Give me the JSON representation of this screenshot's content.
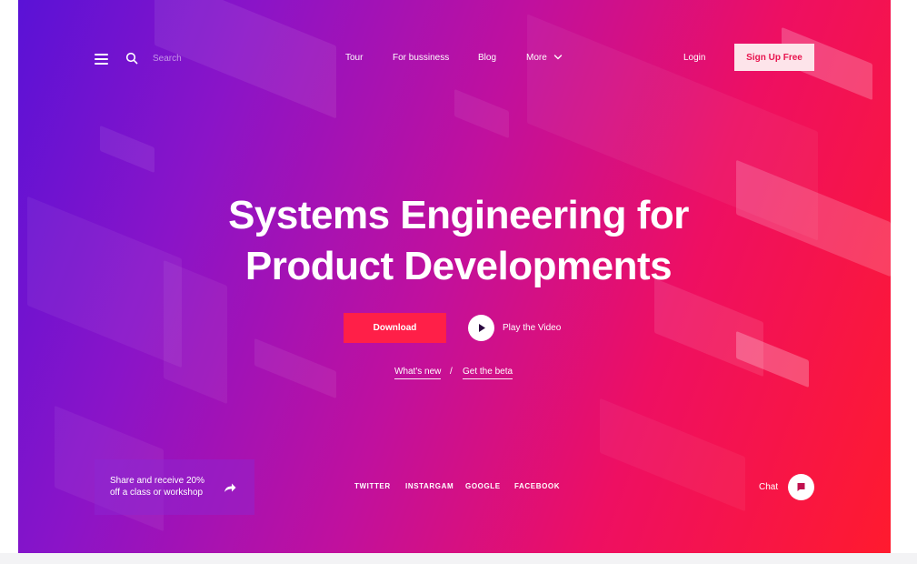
{
  "nav": {
    "search_placeholder": "Search",
    "links": [
      "Tour",
      "For bussiness",
      "Blog",
      "More"
    ],
    "login": "Login",
    "signup": "Sign Up Free"
  },
  "hero": {
    "headline_line1": "Systems Engineering for",
    "headline_line2": "Product Developments",
    "download": "Download",
    "play_video": "Play the Video",
    "whats_new": "What's new",
    "separator": "/",
    "get_beta": "Get the beta"
  },
  "footer": {
    "promo_line1": "Share and receive 20%",
    "promo_line2": "off a class or workshop",
    "socials": [
      "TWITTER",
      "INSTARGAM",
      "GOOGLE",
      "FACEBOOK"
    ],
    "chat": "Chat"
  },
  "colors": {
    "gradient_start": "#5a12d6",
    "gradient_end": "#ff1a2e",
    "accent": "#ff1f48",
    "signup_bg": "#fde4ea"
  },
  "icons": [
    "menu-icon",
    "search-icon",
    "chevron-down-icon",
    "play-icon",
    "share-arrow-icon",
    "chat-icon"
  ]
}
